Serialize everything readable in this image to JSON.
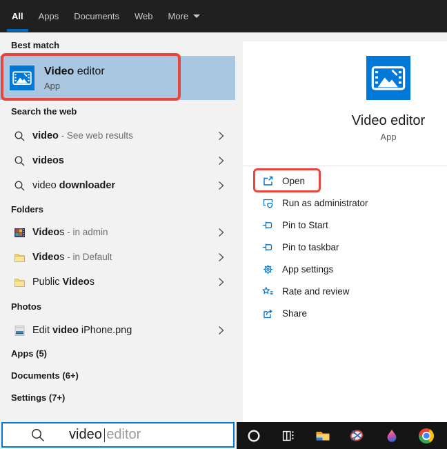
{
  "colors": {
    "accent_blue": "#0078d7",
    "selection_blue": "#a9c7e1",
    "annotation_red": "#e8453c",
    "tab_underline": "#0067b8",
    "topbar_bg": "#202020",
    "taskbar_bg": "#151515",
    "left_panel_bg": "#f2f2f2",
    "right_card_bg": "#ffffff"
  },
  "tabs": {
    "items": [
      {
        "label": "All",
        "active": true
      },
      {
        "label": "Apps",
        "active": false
      },
      {
        "label": "Documents",
        "active": false
      },
      {
        "label": "Web",
        "active": false
      },
      {
        "label": "More",
        "active": false,
        "has_dropdown": true
      }
    ]
  },
  "best_match": {
    "header": "Best match",
    "name_bold": "Video",
    "name_rest": " editor",
    "type": "App"
  },
  "search_web": {
    "header": "Search the web",
    "rows": [
      {
        "pre": "",
        "bold": "video",
        "rest": "",
        "meta": " - See web results"
      },
      {
        "pre": "",
        "bold": "videos",
        "rest": "",
        "meta": ""
      },
      {
        "pre": "video ",
        "bold": "downloader",
        "rest": "",
        "meta": ""
      }
    ]
  },
  "folders": {
    "header": "Folders",
    "rows": [
      {
        "pre": "",
        "bold": "Video",
        "rest": "s",
        "meta": " - in admin",
        "icon": "videos-library-icon"
      },
      {
        "pre": "",
        "bold": "Video",
        "rest": "s",
        "meta": " - in Default",
        "icon": "folder-icon"
      },
      {
        "pre": "Public ",
        "bold": "Video",
        "rest": "s",
        "meta": "",
        "icon": "folder-icon"
      }
    ]
  },
  "photos": {
    "header": "Photos",
    "rows": [
      {
        "pre": "Edit ",
        "bold": "video",
        "rest": " iPhone.png",
        "meta": "",
        "icon": "image-thumbnail-icon"
      }
    ]
  },
  "collapsed_sections": [
    {
      "label": "Apps (5)"
    },
    {
      "label": "Documents (6+)"
    },
    {
      "label": "Settings (7+)"
    }
  ],
  "preview": {
    "app_name": "Video editor",
    "app_type": "App",
    "actions": [
      {
        "label": "Open",
        "icon": "open-icon",
        "highlighted": true
      },
      {
        "label": "Run as administrator",
        "icon": "shield-window-icon",
        "highlighted": false
      },
      {
        "label": "Pin to Start",
        "icon": "pin-icon",
        "highlighted": false
      },
      {
        "label": "Pin to taskbar",
        "icon": "pin-icon",
        "highlighted": false
      },
      {
        "label": "App settings",
        "icon": "gear-icon",
        "highlighted": false
      },
      {
        "label": "Rate and review",
        "icon": "rate-star-icon",
        "highlighted": false
      },
      {
        "label": "Share",
        "icon": "share-icon",
        "highlighted": false
      }
    ]
  },
  "search_box": {
    "query": "video",
    "suggestion": "editor"
  },
  "taskbar": {
    "icons": [
      {
        "name": "cortana-icon"
      },
      {
        "name": "task-view-icon"
      },
      {
        "name": "file-explorer-icon"
      },
      {
        "name": "snip-sketch-icon"
      },
      {
        "name": "paint-3d-icon"
      },
      {
        "name": "chrome-icon"
      }
    ]
  }
}
